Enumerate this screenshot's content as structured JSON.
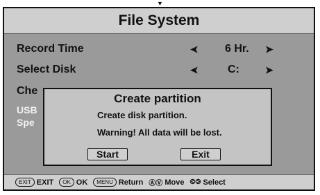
{
  "screen": {
    "title": "File System",
    "top_mark": "▼"
  },
  "menu": {
    "rows": [
      {
        "label": "Record Time",
        "value": "6 Hr."
      },
      {
        "label": "Select Disk",
        "value": "C:"
      },
      {
        "label": "Che"
      },
      {
        "label": "USB"
      },
      {
        "label": "Spe"
      }
    ],
    "left_arrow": "➤",
    "right_arrow": "➤"
  },
  "dialog": {
    "title": "Create partition",
    "line1": "Create disk partition.",
    "line2": "Warning! All data will be lost.",
    "start_label": "Start",
    "exit_label": "Exit"
  },
  "footer": {
    "items": [
      {
        "key": "EXIT",
        "label": "EXIT"
      },
      {
        "key": "OK",
        "label": "OK"
      },
      {
        "key": "MENU",
        "label": "Return"
      },
      {
        "icon": "up-down-icon",
        "label": "Move"
      },
      {
        "icon": "left-right-icon",
        "label": "Select"
      }
    ]
  }
}
